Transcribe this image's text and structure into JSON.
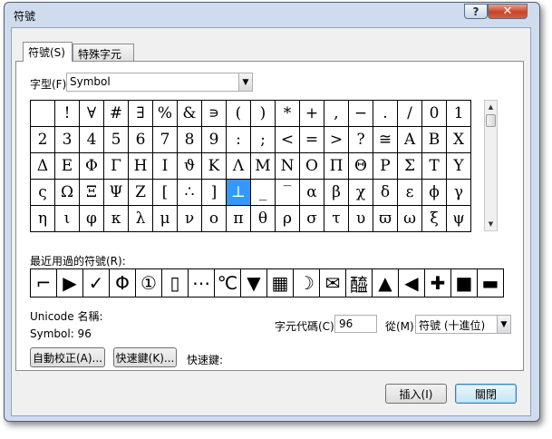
{
  "window": {
    "title": "符號",
    "help_label": "?",
    "close_label": "✕"
  },
  "tabs": [
    {
      "label": "符號(S)"
    },
    {
      "label": "特殊字元(P)"
    }
  ],
  "font": {
    "label": "字型(F):",
    "value": "Symbol"
  },
  "symbols": [
    " ",
    "!",
    "∀",
    "#",
    "∃",
    "%",
    "&",
    "∍",
    "(",
    ")",
    "*",
    "+",
    ",",
    "−",
    ".",
    "/",
    "0",
    "1",
    "2",
    "3",
    "4",
    "5",
    "6",
    "7",
    "8",
    "9",
    ":",
    ";",
    "<",
    "=",
    ">",
    "?",
    "≅",
    "Α",
    "Β",
    "Χ",
    "Δ",
    "Ε",
    "Φ",
    "Γ",
    "Η",
    "Ι",
    "ϑ",
    "Κ",
    "Λ",
    "Μ",
    "Ν",
    "Ο",
    "Π",
    "Θ",
    "Ρ",
    "Σ",
    "Τ",
    "Υ",
    "ς",
    "Ω",
    "Ξ",
    "Ψ",
    "Ζ",
    "[",
    "∴",
    "]",
    "⊥",
    "_",
    "‾",
    "α",
    "β",
    "χ",
    "δ",
    "ε",
    "ϕ",
    "γ",
    "η",
    "ι",
    "φ",
    "κ",
    "λ",
    "μ",
    "ν",
    "ο",
    "π",
    "θ",
    "ρ",
    "σ",
    "τ",
    "υ",
    "ϖ",
    "ω",
    "ξ",
    "ψ"
  ],
  "selected_index": 62,
  "recent": {
    "label": "最近用過的符號(R):",
    "items": [
      "⌐",
      "▶",
      "✓",
      "Φ",
      "①",
      "▯",
      "⋯",
      "℃",
      "▼",
      "▦",
      "☽",
      "✉",
      "醯",
      "▲",
      "◀",
      "✚",
      "■",
      "▬"
    ]
  },
  "unicode_name": {
    "label": "Unicode 名稱:",
    "value": "Symbol: 96"
  },
  "char_code": {
    "label": "字元代碼(C):",
    "value": "96"
  },
  "from": {
    "label": "從(M):",
    "value": "符號 (十進位)"
  },
  "buttons": {
    "autocorrect": "自動校正(A)...",
    "shortcut_key": "快速鍵(K)...",
    "shortcut_label": "快速鍵:",
    "insert": "插入(I)",
    "close": "關閉"
  }
}
